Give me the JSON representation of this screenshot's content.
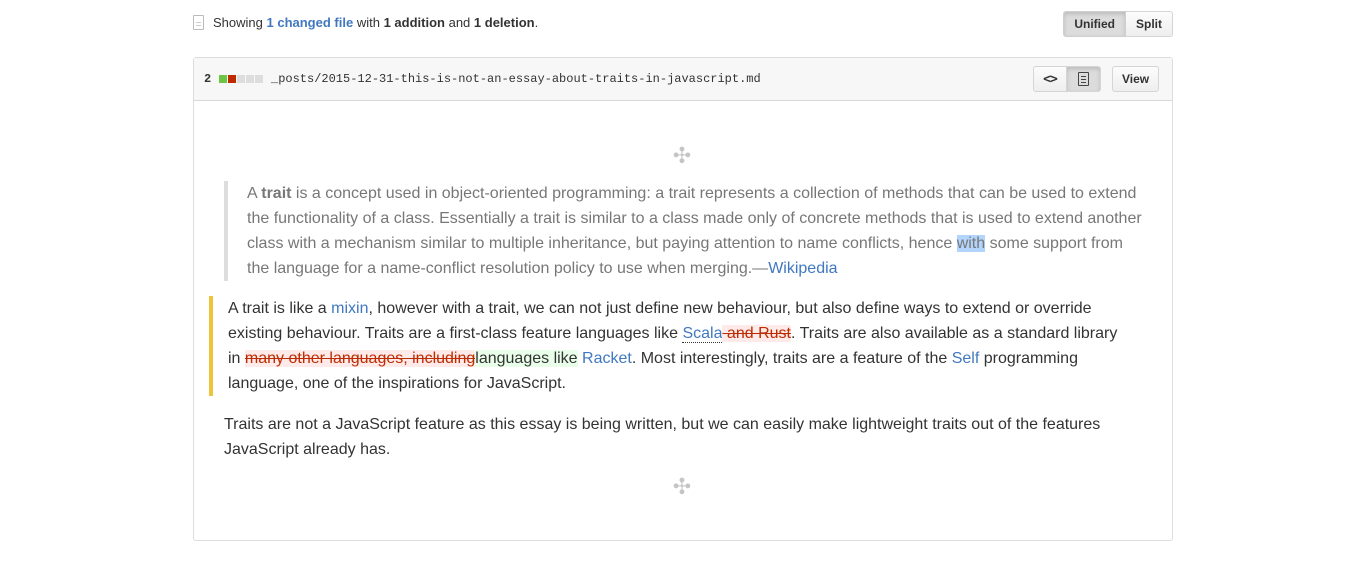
{
  "toolbar": {
    "showing": "Showing",
    "changed_files": "1 changed file",
    "with": "with",
    "additions": "1 addition",
    "and": "and",
    "deletions": "1 deletion",
    "period": ".",
    "unified_label": "Unified",
    "split_label": "Split",
    "selected_view": "Unified"
  },
  "file": {
    "diffstat_count": "2",
    "diffstat_blocks": [
      "add",
      "del",
      "neutral",
      "neutral",
      "neutral"
    ],
    "path": "_posts/2015-12-31-this-is-not-an-essay-about-traits-in-javascript.md",
    "source_icon": "code-icon",
    "rich_icon": "file-text-icon",
    "view_label": "View"
  },
  "quote": {
    "a": "A ",
    "trait_bold": "trait",
    "text_1": " is a concept used in object-oriented programming: a trait represents a collection of methods that can be used to extend the functionality of a class. Essentially a trait is similar to a class made only of concrete methods that is used to extend another class with a mechanism similar to multiple inheritance, but paying attention to name conflicts, hence ",
    "highlight": "with",
    "text_2": " some support from the language for a name-conflict resolution policy to use when merging.—",
    "source_link": "Wikipedia"
  },
  "changed_paragraph": {
    "t1": "A trait is like a ",
    "mixin": "mixin",
    "t2": ", however with a trait, we can not just define new behaviour, but also define ways to extend or override existing behaviour. Traits are a first-class feature languages like ",
    "scala": "Scala",
    "removed_1": " and Rust",
    "t3": ". Traits are also available as a standard library in ",
    "removed_2": "many other languages, including",
    "added": "languages like",
    "t4": " ",
    "racket": "Racket",
    "t5": ". Most interestingly, traits are a feature of the ",
    "self": "Self",
    "t6": " programming language, one of the inspirations for JavaScript."
  },
  "paragraph_2": "Traits are not a JavaScript feature as this essay is being written, but we can easily make lightweight traits out of the features JavaScript already has.",
  "colors": {
    "link": "#4078c0",
    "addition": "#6cc644",
    "deletion": "#bd2c00",
    "change_marker": "#f0c43a",
    "selection": "#b3d4fc"
  },
  "icons": {
    "expand_top": "unfold-icon",
    "expand_bottom": "unfold-icon"
  }
}
